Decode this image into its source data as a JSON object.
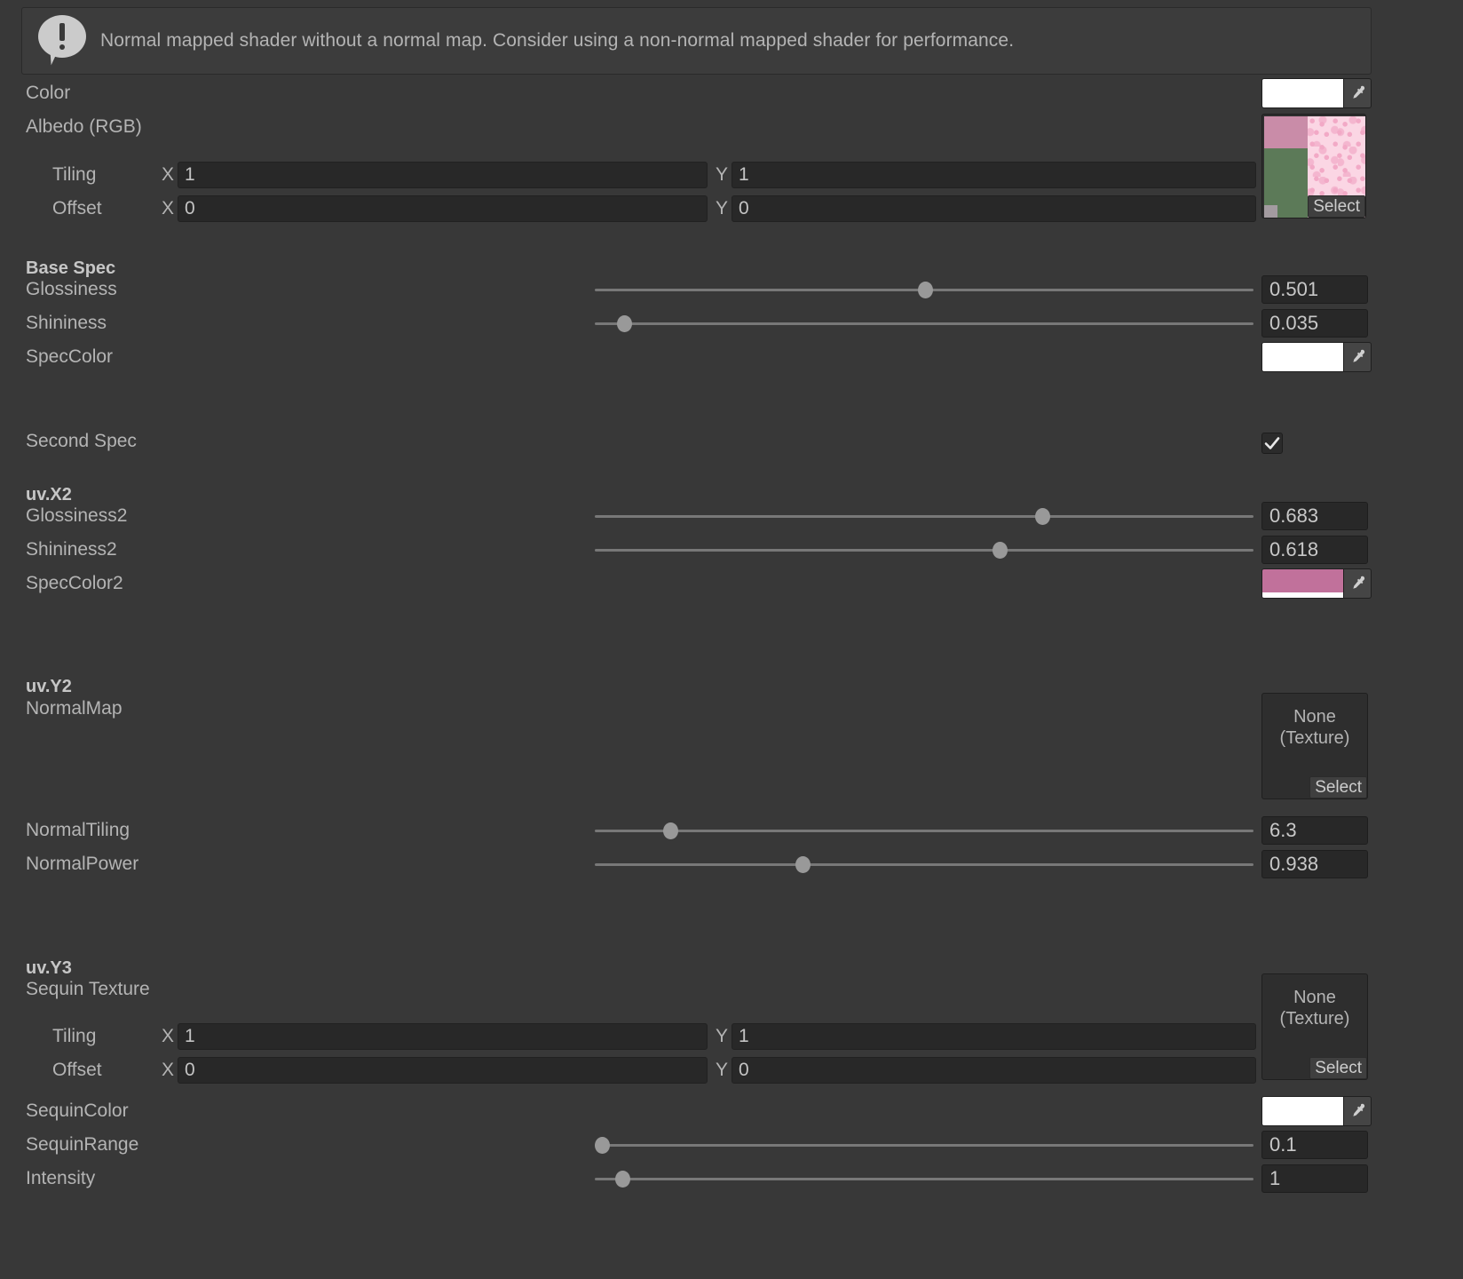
{
  "helpbox": {
    "icon": "warning-icon",
    "message": "Normal mapped shader without a normal map. Consider using a non-normal mapped shader for performance."
  },
  "rows": {
    "color": {
      "label": "Color",
      "swatch_color": "#ffffff"
    },
    "albedo": {
      "label": "Albedo (RGB)",
      "tiling_label": "Tiling",
      "offset_label": "Offset",
      "x_letter": "X",
      "y_letter": "Y",
      "tiling_x": "1",
      "tiling_y": "1",
      "offset_x": "0",
      "offset_y": "0",
      "select_label": "Select"
    },
    "base_spec_header": {
      "label": "Base Spec"
    },
    "glossiness": {
      "label": "Glossiness",
      "value": "0.501",
      "fraction": 0.501
    },
    "shininess": {
      "label": "Shininess",
      "value": "0.035",
      "fraction": 0.045
    },
    "spec_color": {
      "label": "SpecColor",
      "swatch_color": "#ffffff"
    },
    "second_spec": {
      "label": "Second Spec",
      "checked": true
    },
    "uv_x2_header": {
      "label": "uv.X2"
    },
    "glossiness2": {
      "label": "Glossiness2",
      "value": "0.683",
      "fraction": 0.679
    },
    "shininess2": {
      "label": "Shininess2",
      "value": "0.618",
      "fraction": 0.614
    },
    "spec_color2": {
      "label": "SpecColor2",
      "swatch_color": "#c1719b"
    },
    "uv_y2_header": {
      "label": "uv.Y2"
    },
    "normal_map": {
      "label": "NormalMap",
      "none_line1": "None",
      "none_line2": "(Texture)",
      "select_label": "Select"
    },
    "normal_tiling": {
      "label": "NormalTiling",
      "value": "6.3",
      "fraction": 0.115
    },
    "normal_power": {
      "label": "NormalPower",
      "value": "0.938",
      "fraction": 0.316
    },
    "uv_y3_header": {
      "label": "uv.Y3"
    },
    "sequin_texture": {
      "label": "Sequin Texture",
      "tiling_label": "Tiling",
      "offset_label": "Offset",
      "x_letter": "X",
      "y_letter": "Y",
      "tiling_x": "1",
      "tiling_y": "1",
      "offset_x": "0",
      "offset_y": "0",
      "none_line1": "None",
      "none_line2": "(Texture)",
      "select_label": "Select"
    },
    "sequin_color": {
      "label": "SequinColor",
      "swatch_color": "#ffffff"
    },
    "sequin_range": {
      "label": "SequinRange",
      "value": "0.1",
      "fraction": 0.011
    },
    "intensity": {
      "label": "Intensity",
      "value": "1",
      "fraction": 0.042
    }
  }
}
